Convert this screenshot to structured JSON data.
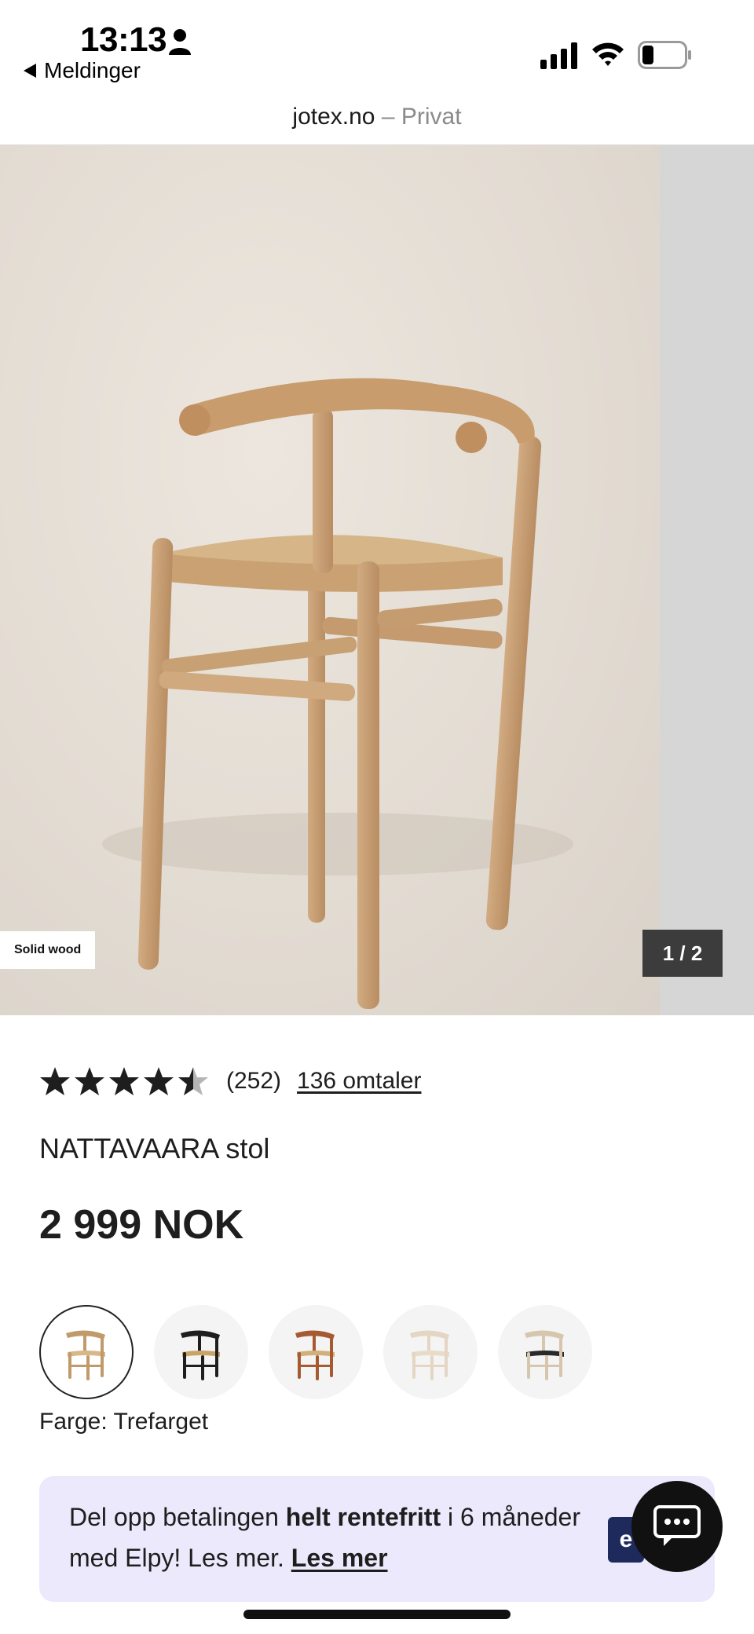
{
  "status_bar": {
    "time": "13:13",
    "back_label": "Meldinger"
  },
  "url_bar": {
    "domain": "jotex.no",
    "dash": "–",
    "mode": "Privat"
  },
  "gallery": {
    "badge": "Solid wood",
    "counter": "1 / 2"
  },
  "product": {
    "rating": 4.5,
    "rating_max": 5,
    "rating_count": "(252)",
    "reviews_link": "136 omtaler",
    "title": "NATTAVAARA stol",
    "price": "2 999 NOK",
    "color_label": "Farge: Trefarget",
    "variants": [
      {
        "name": "natural-oak",
        "frame": "#c19a6b",
        "seat": "#d8b889",
        "selected": true
      },
      {
        "name": "black",
        "frame": "#1e1e1e",
        "seat": "#c9a46a",
        "selected": false
      },
      {
        "name": "cherry",
        "frame": "#a65a32",
        "seat": "#d3b07a",
        "selected": false
      },
      {
        "name": "white-wash",
        "frame": "#e4d6c2",
        "seat": "#e8dcc8",
        "selected": false
      },
      {
        "name": "white-black-seat",
        "frame": "#d7c6ae",
        "seat": "#2a2a2a",
        "selected": false
      }
    ]
  },
  "finance": {
    "text_1": "Del opp betalingen ",
    "bold": "helt rentefritt",
    "text_2": " i 6 måneder med Elpy! Les mer. ",
    "link": "Les mer",
    "logo": "e"
  },
  "colors": {
    "wood": "#c9a077",
    "banner_bg": "#ebe9fb",
    "counter_bg": "#3c3c3c"
  }
}
